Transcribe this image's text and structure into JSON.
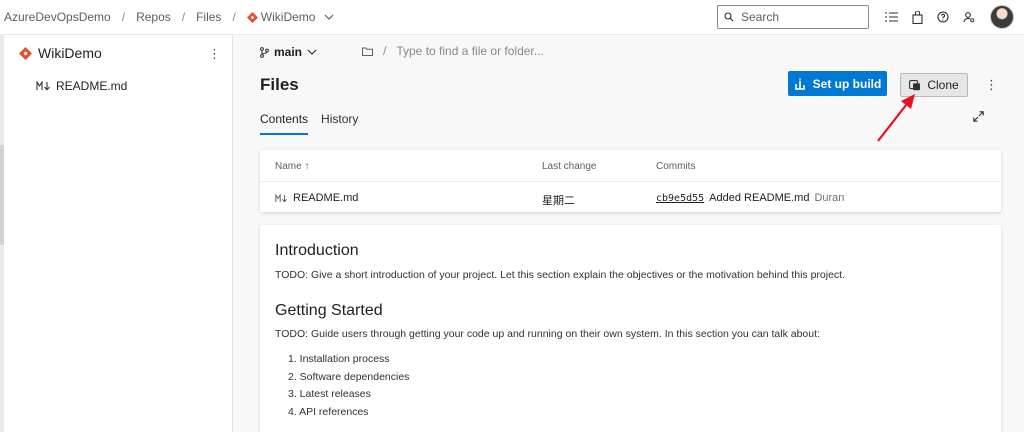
{
  "breadcrumb": {
    "org": "AzureDevOpsDemo",
    "section": "Repos",
    "page": "Files",
    "repo": "WikiDemo"
  },
  "search": {
    "placeholder": "Search"
  },
  "sidebar": {
    "repo_name": "WikiDemo",
    "more": "⋮",
    "items": [
      {
        "label": "README.md"
      }
    ]
  },
  "toolbar": {
    "branch": "main",
    "path_placeholder": "Type to find a file or folder...",
    "title": "Files",
    "setup_build_label": "Set up build",
    "clone_label": "Clone",
    "more": "⋮"
  },
  "tabs": [
    {
      "label": "Contents",
      "active": true
    },
    {
      "label": "History",
      "active": false
    }
  ],
  "file_table": {
    "headers": {
      "name": "Name ↑",
      "last_change": "Last change",
      "commits": "Commits"
    },
    "rows": [
      {
        "name": "README.md",
        "last_change": "星期二",
        "commit_id": "cb9e5d55",
        "message": "Added README.md",
        "author": "Duran"
      }
    ]
  },
  "readme": {
    "intro_heading": "Introduction",
    "intro_text": "TODO: Give a short introduction of your project. Let this section explain the objectives or the motivation behind this project.",
    "gs_heading": "Getting Started",
    "gs_text": "TODO: Guide users through getting your code up and running on their own system. In this section you can talk about:",
    "list": [
      "1. Installation process",
      "2. Software dependencies",
      "3. Latest releases",
      "4. API references"
    ]
  },
  "colors": {
    "accent": "#0078d4",
    "repo_icon": "#e84e2b",
    "annotation_arrow": "#e81123"
  }
}
